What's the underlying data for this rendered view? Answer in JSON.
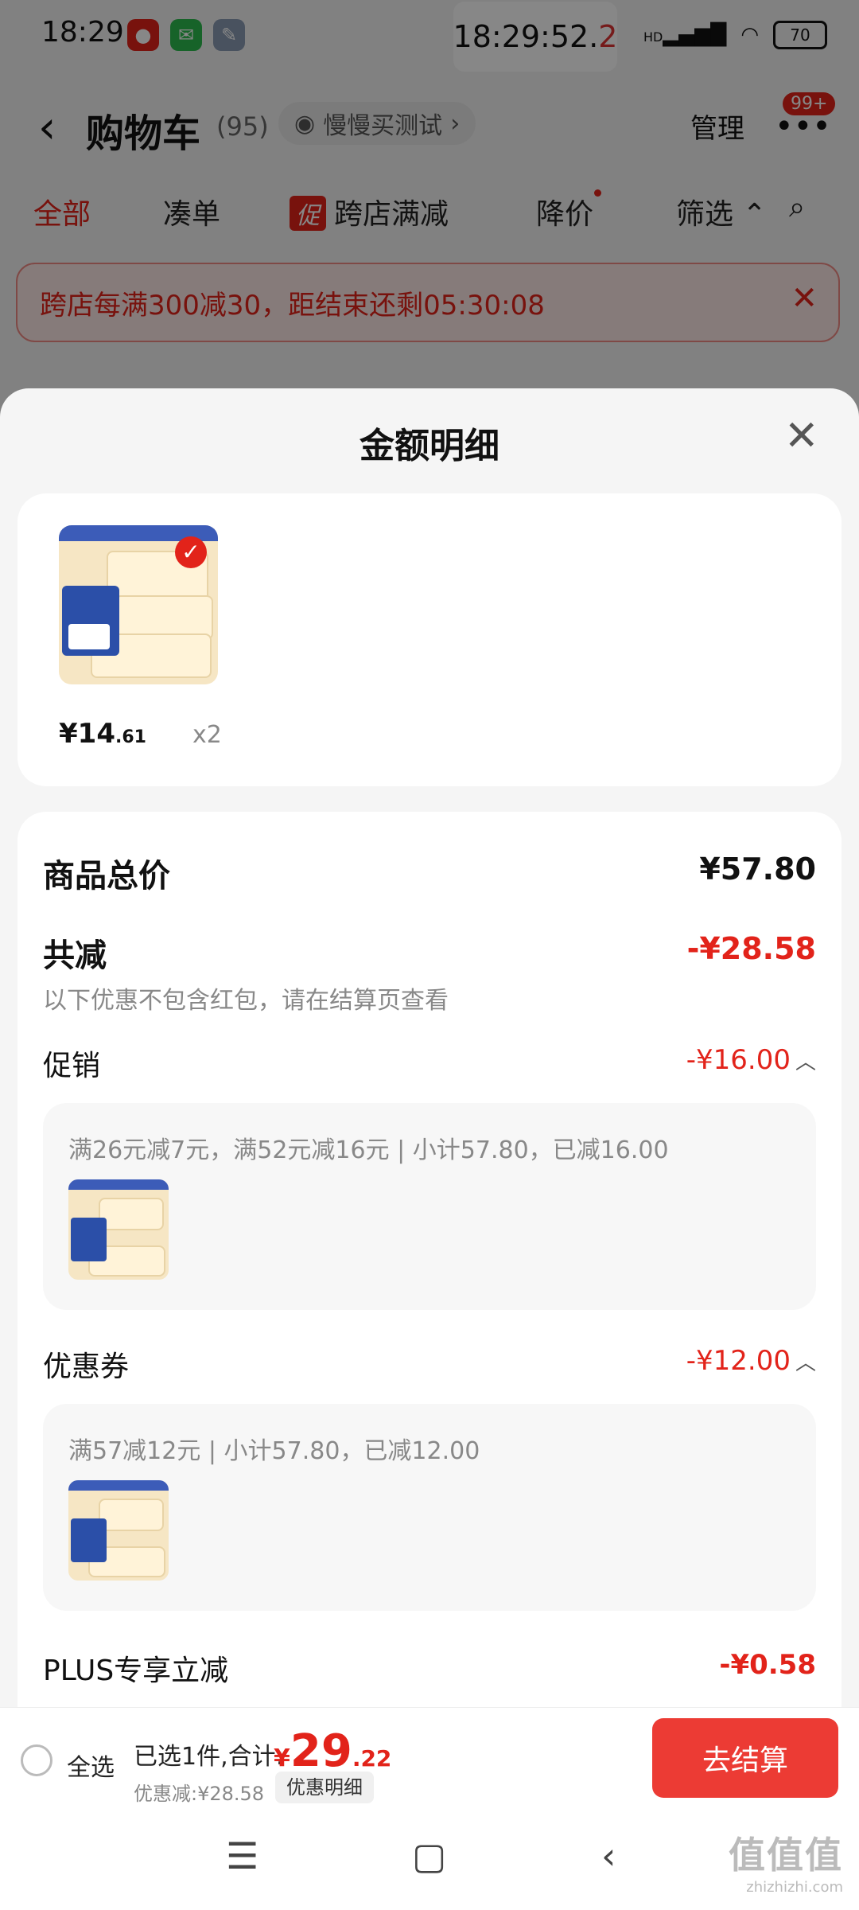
{
  "status": {
    "time": "18:29",
    "clock_main": "18:29:52.",
    "clock_tail": "2",
    "network": "HD",
    "battery": "70"
  },
  "nav": {
    "title": "购物车",
    "count": "(95)",
    "chip_label": "慢慢买测试",
    "manage": "管理",
    "badge": "99+"
  },
  "tabs": {
    "all": "全部",
    "bundle": "凑单",
    "promo_tag": "促",
    "cross_store": "跨店满减",
    "price_drop": "降价",
    "filter": "筛选"
  },
  "banner": {
    "text": "跨店每满300减30，距结束还剩05:30:08"
  },
  "sheet": {
    "title": "金额明细",
    "item": {
      "price_prefix": "¥14",
      "price_decimal": ".61",
      "qty": "x2"
    },
    "total_label": "商品总价",
    "total_value": "¥57.80",
    "reduce_label": "共减",
    "reduce_value": "-¥28.58",
    "reduce_note": "以下优惠不包含红包，请在结算页查看",
    "promo": {
      "label": "促销",
      "value": "-¥16.00",
      "detail": "满26元减7元，满52元减16元 | 小计57.80，已减16.00"
    },
    "coupon": {
      "label": "优惠券",
      "value": "-¥12.00",
      "detail": "满57减12元 | 小计57.80，已减12.00"
    },
    "plus": {
      "label": "PLUS专享立减",
      "value": "-¥0.58"
    }
  },
  "checkout": {
    "select_all": "全选",
    "summary": "已选1件,合计:",
    "currency": "¥",
    "total_int": "29",
    "total_dec": ".22",
    "discount": "优惠减:¥28.58",
    "detail_button": "优惠明细",
    "checkout_button": "去结算"
  },
  "watermark": {
    "big": "值值值",
    "small": "zhizhizhi.com"
  },
  "colors": {
    "accent": "#e2231a",
    "checkout_button": "#ec3b34"
  }
}
